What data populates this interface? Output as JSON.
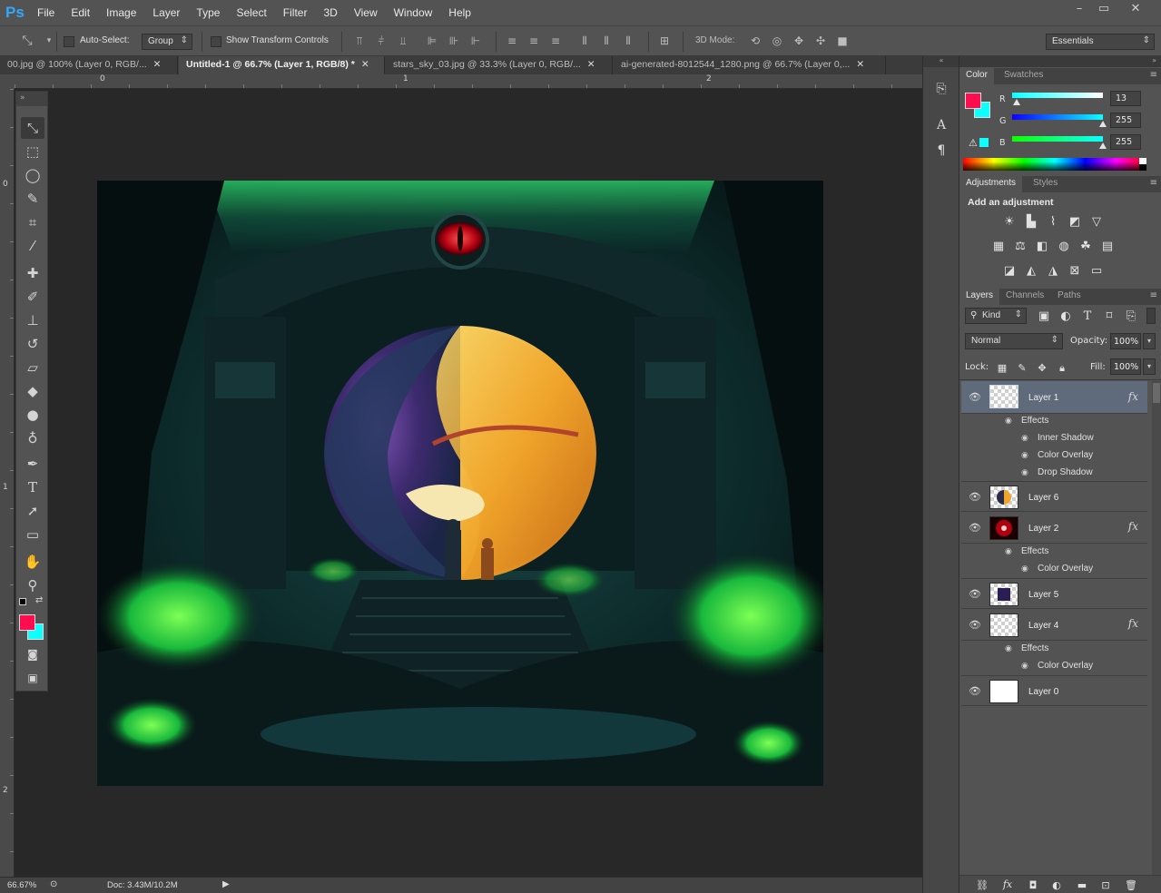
{
  "app": {
    "logo": "Ps"
  },
  "menubar": {
    "items": [
      "File",
      "Edit",
      "Image",
      "Layer",
      "Type",
      "Select",
      "Filter",
      "3D",
      "View",
      "Window",
      "Help"
    ]
  },
  "window_controls": {
    "minimize": "–",
    "restore": "▭",
    "close": "✕"
  },
  "options": {
    "auto_select_label": "Auto-Select:",
    "auto_select_value": "Group",
    "show_transform_label": "Show Transform Controls",
    "mode3d_label": "3D Mode:",
    "workspace": "Essentials"
  },
  "tabs": [
    {
      "label": "00.jpg @ 100% (Layer 0, RGB/...",
      "close": "✕"
    },
    {
      "label": "Untitled-1 @ 66.7% (Layer 1, RGB/8) *",
      "close": "✕"
    },
    {
      "label": "stars_sky_03.jpg @ 33.3% (Layer 0, RGB/...",
      "close": "✕"
    },
    {
      "label": "ai-generated-8012544_1280.png @ 66.7% (Layer 0,...",
      "close": "✕"
    }
  ],
  "ruler": {
    "h_marks": [
      "0",
      "1",
      "2"
    ],
    "v_marks": [
      "0",
      "1",
      "2"
    ]
  },
  "status": {
    "zoom": "66.67%",
    "doc": "Doc: 3.43M/10.2M"
  },
  "color_panel": {
    "tabs": [
      "Color",
      "Swatches"
    ],
    "channels": [
      {
        "label": "R",
        "value": "13",
        "fraction": 0.05
      },
      {
        "label": "G",
        "value": "255",
        "fraction": 1.0
      },
      {
        "label": "B",
        "value": "255",
        "fraction": 1.0
      }
    ],
    "foreground": "#ff0d4e",
    "background": "#0dffff"
  },
  "adjustments_panel": {
    "tabs": [
      "Adjustments",
      "Styles"
    ],
    "title": "Add an adjustment"
  },
  "layers_panel": {
    "tabs": [
      "Layers",
      "Channels",
      "Paths"
    ],
    "kind_label": "Kind",
    "blend_mode": "Normal",
    "opacity_label": "Opacity:",
    "opacity_value": "100%",
    "lock_label": "Lock:",
    "fill_label": "Fill:",
    "fill_value": "100%",
    "fx_label": "fx",
    "effects_label": "Effects",
    "layers": [
      {
        "name": "Layer 1",
        "effects": [
          "Inner Shadow",
          "Color Overlay",
          "Drop Shadow"
        ]
      },
      {
        "name": "Layer 6"
      },
      {
        "name": "Layer 2",
        "effects": [
          "Color Overlay"
        ]
      },
      {
        "name": "Layer 5"
      },
      {
        "name": "Layer 4",
        "effects": [
          "Color Overlay"
        ]
      },
      {
        "name": "Layer 0"
      }
    ]
  },
  "colors": {
    "accent": "#31a8ff",
    "fg_swatch": "#ff0d4e",
    "bg_swatch": "#0dffff"
  }
}
